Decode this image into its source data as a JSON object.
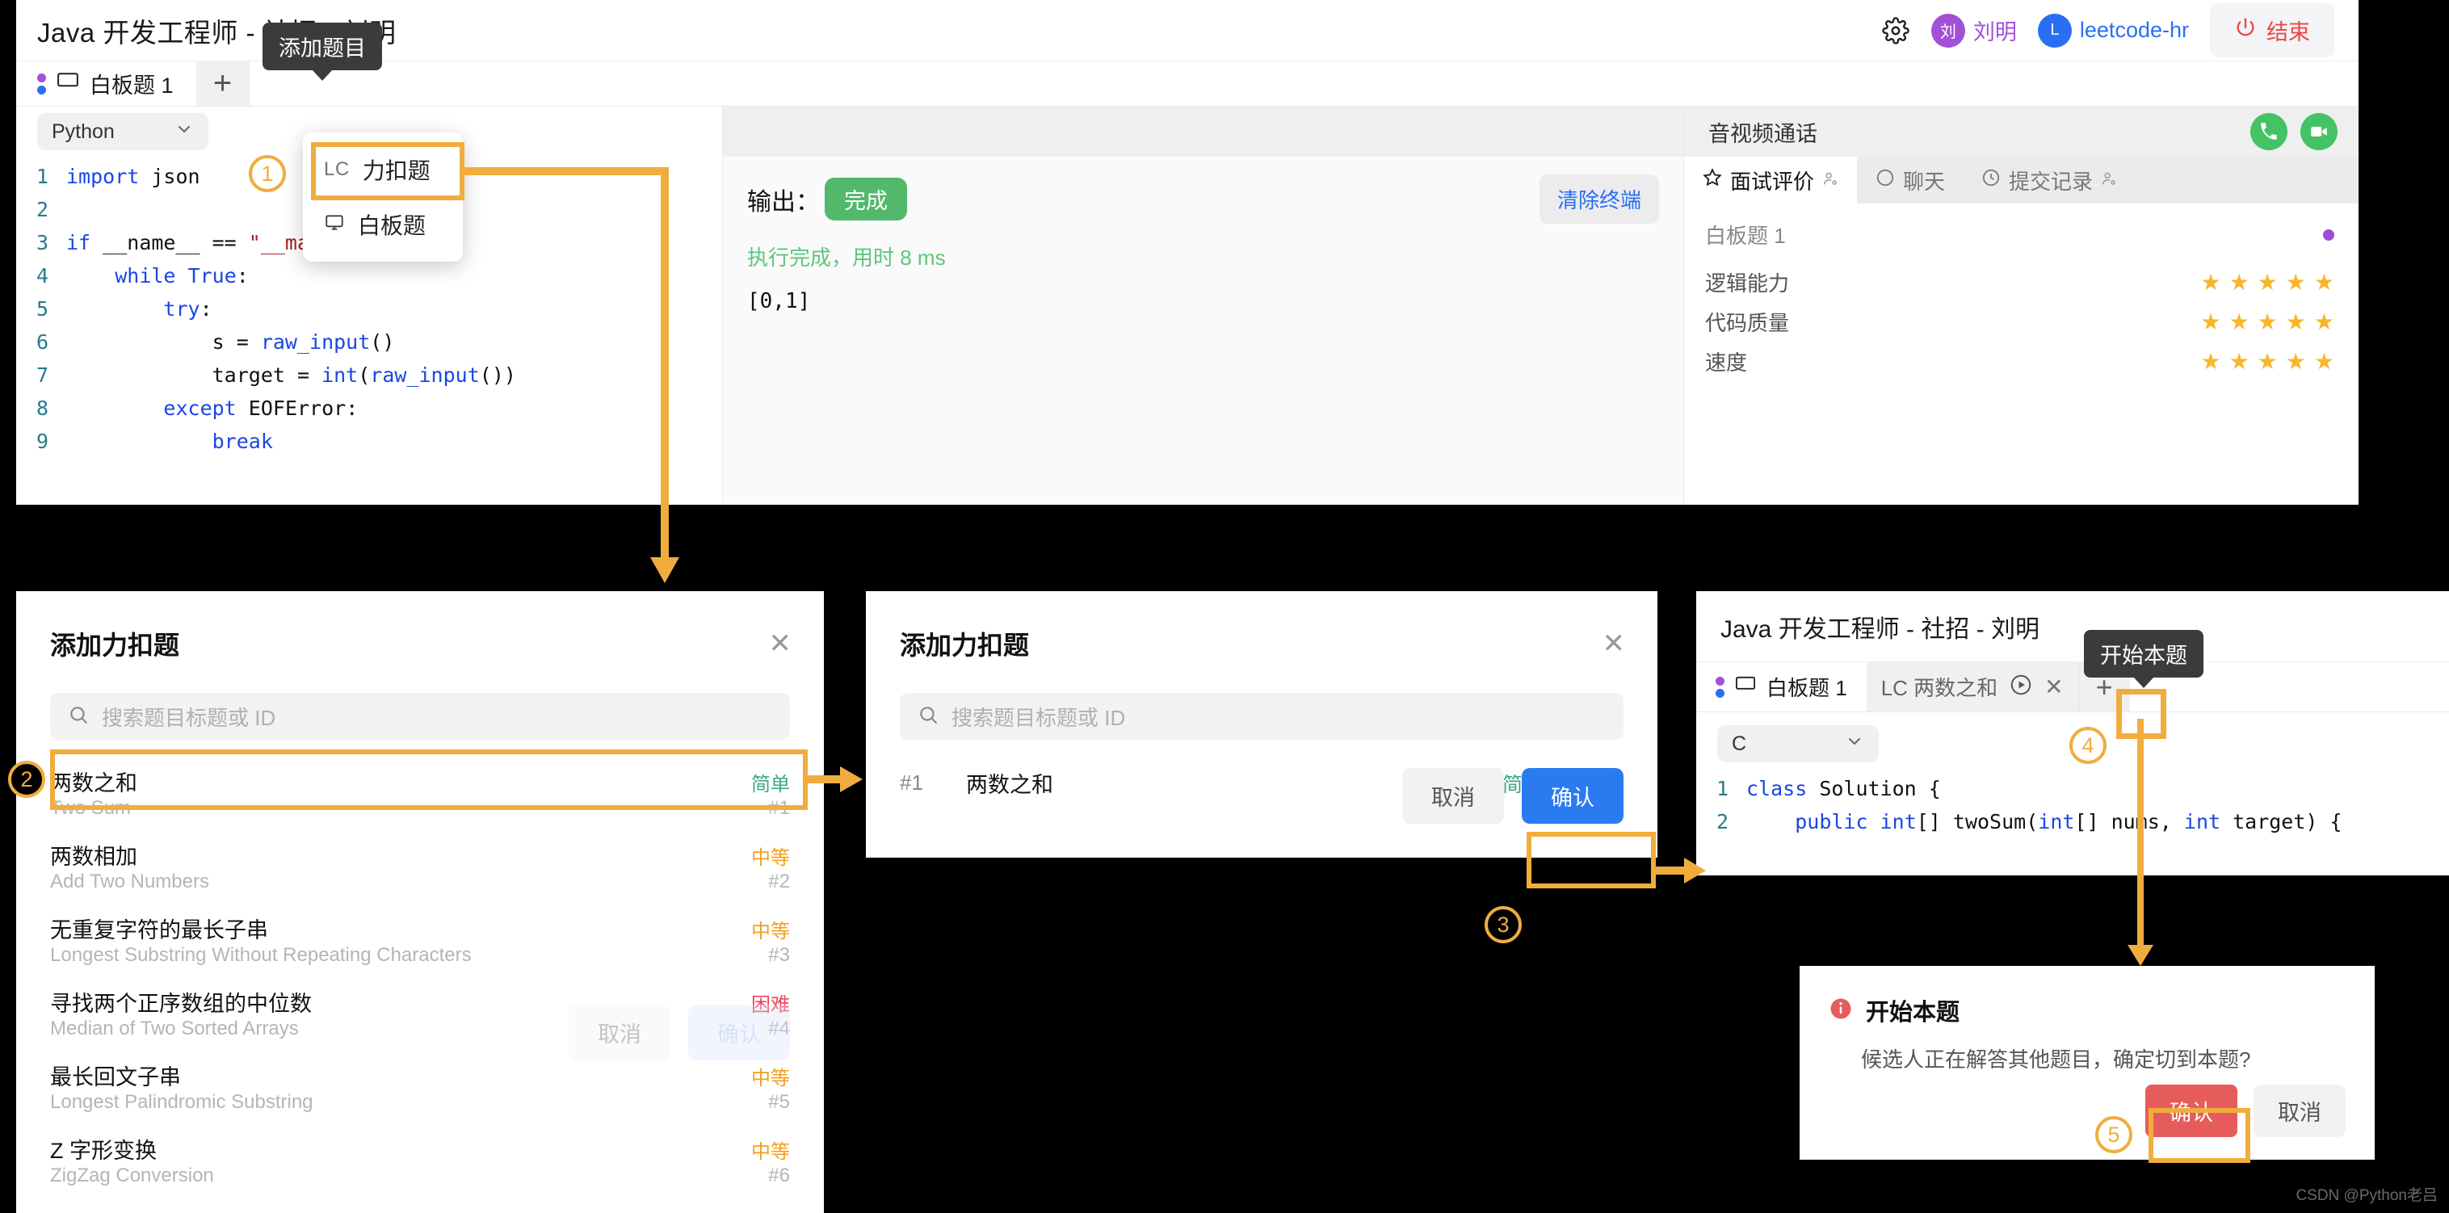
{
  "app": {
    "title": "Java 开发工程师 - 社招 - 刘明",
    "header": {
      "gear_icon": "gear-icon",
      "user1_initial": "刘",
      "user1_name": "刘明",
      "user2_initial": "L",
      "user2_name": "leetcode-hr",
      "end_button": "结束",
      "power_icon": "power-icon"
    },
    "tabs": {
      "whiteboard_tab": "白板题 1",
      "add_tab_icon": "plus-icon",
      "add_tab_tooltip": "添加题目"
    },
    "editor": {
      "language": "Python",
      "chevron_icon": "chevron-down-icon",
      "lines": [
        {
          "n": "1",
          "html": "<span class='kw'>import</span> json"
        },
        {
          "n": "2",
          "html": ""
        },
        {
          "n": "3",
          "html": "<span class='kw'>if</span> __name__ == <span class='str'>\"__main__\"</span>:"
        },
        {
          "n": "4",
          "html": "    <span class='kw'>while</span> <span class='kw'>True</span>:"
        },
        {
          "n": "5",
          "html": "        <span class='kw'>try</span>:"
        },
        {
          "n": "6",
          "html": "            s = <span class='fn'>raw_input</span>()"
        },
        {
          "n": "7",
          "html": "            target = <span class='fn'>int</span>(<span class='fn'>raw_input</span>())"
        },
        {
          "n": "8",
          "html": "        <span class='kw'>except</span> EOFError:"
        },
        {
          "n": "9",
          "html": "            <span class='kw'>break</span>"
        }
      ]
    },
    "output": {
      "label": "输出：",
      "status": "完成",
      "clear_button": "清除终端",
      "message": "执行完成，用时 8 ms",
      "value": "[0,1]"
    },
    "sidepanel": {
      "call_label": "音视频通话",
      "phone_icon": "phone-icon",
      "video_icon": "video-camera-icon",
      "tabs": [
        {
          "label": "面试评价",
          "icon": "star-icon",
          "badge_icon": "person-icon",
          "active": true
        },
        {
          "label": "聊天",
          "icon": "chat-icon",
          "active": false
        },
        {
          "label": "提交记录",
          "icon": "clock-icon",
          "badge_icon": "person-icon",
          "active": false
        }
      ],
      "eval_title": "白板题 1",
      "eval_rows": [
        {
          "name": "逻辑能力",
          "stars": 5
        },
        {
          "name": "代码质量",
          "stars": 5
        },
        {
          "name": "速度",
          "stars": 5
        }
      ]
    }
  },
  "menu": {
    "items": [
      {
        "label": "力扣题",
        "icon": "lc-icon",
        "highlighted": true
      },
      {
        "label": "白板题",
        "icon": "monitor-icon",
        "highlighted": false
      }
    ]
  },
  "dialog_list": {
    "title": "添加力扣题",
    "close_icon": "close-icon",
    "search_placeholder": "搜索题目标题或 ID",
    "search_icon": "search-icon",
    "problems": [
      {
        "zh": "两数之和",
        "en": "Two Sum",
        "difficulty": "简单",
        "level": "easy",
        "id": "#1",
        "selected": true
      },
      {
        "zh": "两数相加",
        "en": "Add Two Numbers",
        "difficulty": "中等",
        "level": "med",
        "id": "#2",
        "selected": false
      },
      {
        "zh": "无重复字符的最长子串",
        "en": "Longest Substring Without Repeating Characters",
        "difficulty": "中等",
        "level": "med",
        "id": "#3",
        "selected": false
      },
      {
        "zh": "寻找两个正序数组的中位数",
        "en": "Median of Two Sorted Arrays",
        "difficulty": "困难",
        "level": "hard",
        "id": "#4",
        "selected": false
      },
      {
        "zh": "最长回文子串",
        "en": "Longest Palindromic Substring",
        "difficulty": "中等",
        "level": "med",
        "id": "#5",
        "selected": false
      },
      {
        "zh": "Z 字形变换",
        "en": "ZigZag Conversion",
        "difficulty": "中等",
        "level": "med",
        "id": "#6",
        "selected": false
      }
    ],
    "cancel_button": "取消",
    "confirm_button": "确认"
  },
  "dialog_selected": {
    "title": "添加力扣题",
    "close_icon": "close-icon",
    "search_placeholder": "搜索题目标题或 ID",
    "search_icon": "search-icon",
    "row": {
      "id": "#1",
      "name": "两数之和",
      "difficulty": "简单",
      "lang_icon": "translate-icon",
      "delete_icon": "trash-icon"
    },
    "cancel_button": "取消",
    "confirm_button": "确认"
  },
  "panel_interview": {
    "title": "Java 开发工程师 - 社招 - 刘明",
    "whiteboard_tab": "白板题 1",
    "lc_tab": "LC 两数之和",
    "play_icon": "play-circle-icon",
    "close_icon": "close-icon",
    "add_icon": "plus-icon",
    "tooltip": "开始本题",
    "language": "C",
    "chevron_icon": "chevron-down-icon",
    "lines": [
      {
        "n": "1",
        "html": "<span class='kw'>class</span> Solution {"
      },
      {
        "n": "2",
        "html": "    <span class='kw'>public</span> <span class='kw'>int</span>[] twoSum(<span class='kw'>int</span>[] nums, <span class='kw'>int</span> target) {"
      }
    ]
  },
  "dialog_confirm": {
    "info_icon": "info-icon",
    "title": "开始本题",
    "message": "候选人正在解答其他题目，确定切到本题?",
    "confirm_button": "确认",
    "cancel_button": "取消"
  },
  "annotations": {
    "steps": [
      "1",
      "2",
      "3",
      "4",
      "5"
    ],
    "accent_color": "#f0ad3e"
  },
  "watermark": "CSDN @Python老吕"
}
